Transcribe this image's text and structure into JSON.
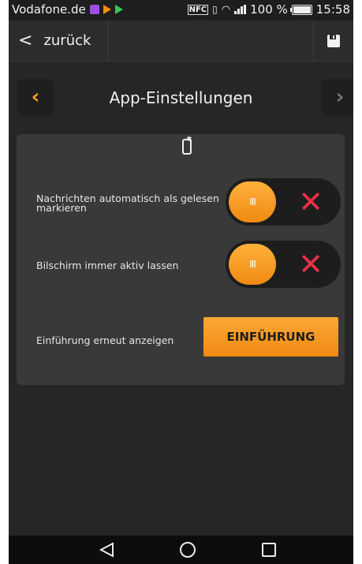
{
  "status_bar": {
    "carrier": "Vodafone.de",
    "nfc_label": "NFC",
    "battery_percent": "100 %",
    "time": "15:58",
    "icons": [
      "photos-icon",
      "play-store-orange-icon",
      "play-store-icon",
      "nfc-icon",
      "vibrate-icon",
      "wifi-icon",
      "signal-icon",
      "battery-icon"
    ]
  },
  "top_bar": {
    "back_label": "zurück",
    "back_icon": "chevron-left-icon",
    "save_icon": "save-icon"
  },
  "header": {
    "title": "App-Einstellungen",
    "prev_arrow": "‹",
    "next_arrow": "›"
  },
  "settings": {
    "panel_icon": "phone-settings-icon",
    "rows": [
      {
        "label": "Nachrichten automatisch als gelesen markieren",
        "knob_glyph": "III",
        "off_glyph": "✕"
      },
      {
        "label": "Bilschirm immer aktiv lassen",
        "knob_glyph": "III",
        "off_glyph": "✕"
      },
      {
        "label": "Einführung erneut anzeigen",
        "button": "EINFÜHRUNG"
      }
    ]
  },
  "colors": {
    "accent": "#f7a028",
    "background": "#262626",
    "panel": "#393939",
    "off_mark": "#e63246"
  },
  "android_nav": {
    "icons": [
      "back-triangle-icon",
      "home-circle-icon",
      "recents-square-icon"
    ]
  }
}
